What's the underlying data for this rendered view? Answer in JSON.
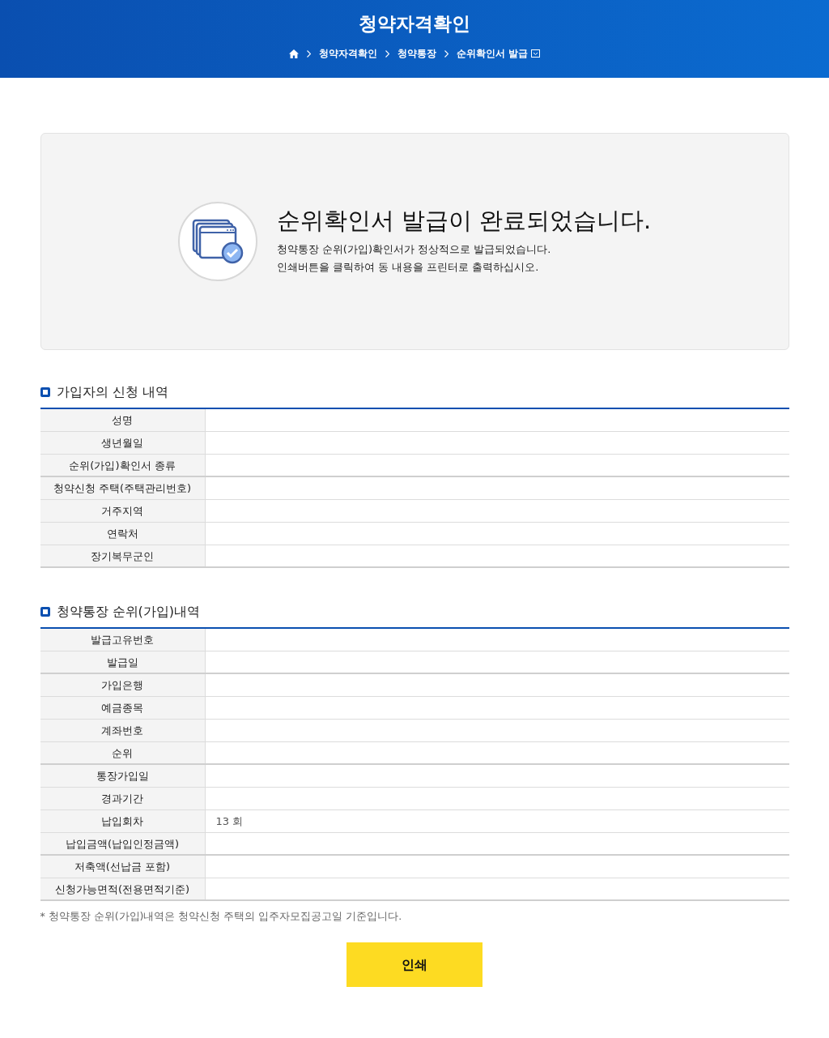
{
  "header": {
    "title": "청약자격확인",
    "breadcrumb": [
      "청약자격확인",
      "청약통장",
      "순위확인서 발급"
    ]
  },
  "notice": {
    "heading": "순위확인서 발급이 완료되었습니다.",
    "lines": [
      "청약통장 순위(가입)확인서가 정상적으로 발급되었습니다.",
      "인쇄버튼을 클릭하여 동 내용을 프린터로 출력하십시오."
    ]
  },
  "sections": [
    {
      "title": "가입자의 신청 내역",
      "rows": [
        {
          "label": "성명",
          "group_end": false
        },
        {
          "label": "생년월일",
          "group_end": false
        },
        {
          "label": "순위(가입)확인서 종류",
          "group_end": true
        },
        {
          "label": "청약신청 주택(주택관리번호)",
          "group_end": false
        },
        {
          "label": "거주지역",
          "group_end": false
        },
        {
          "label": "연락처",
          "group_end": false
        },
        {
          "label": "장기복무군인",
          "group_end": true
        }
      ]
    },
    {
      "title": "청약통장 순위(가입)내역",
      "rows": [
        {
          "label": "발급고유번호",
          "group_end": false
        },
        {
          "label": "발급일",
          "group_end": true
        },
        {
          "label": "가입은행",
          "group_end": false
        },
        {
          "label": "예금종목",
          "group_end": false
        },
        {
          "label": "계좌번호",
          "group_end": false
        },
        {
          "label": "순위",
          "group_end": true
        },
        {
          "label": "통장가입일",
          "group_end": false
        },
        {
          "label": "경과기간",
          "group_end": false
        },
        {
          "label": "납입회차",
          "value": "13 회",
          "group_end": false
        },
        {
          "label": "납입금액(납입인정금액)",
          "group_end": true
        },
        {
          "label": "저축액(선납금 포함)",
          "group_end": false
        },
        {
          "label": "신청가능면적(전용면적기준)",
          "group_end": true
        }
      ]
    }
  ],
  "footnote": "* 청약통장 순위(가입)내역은 청약신청 주택의 입주자모집공고일 기준입니다.",
  "print_button": "인쇄"
}
